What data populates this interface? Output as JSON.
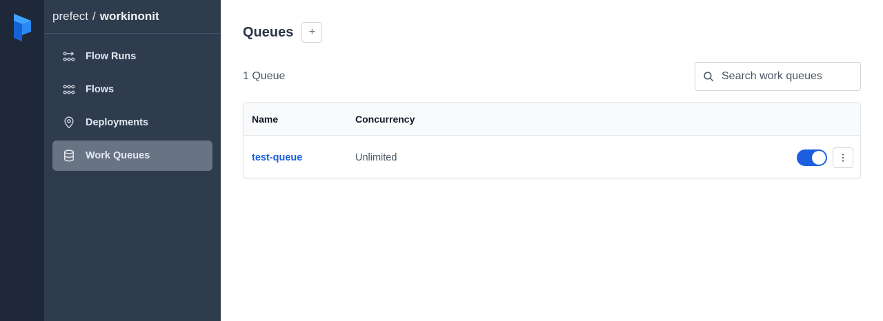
{
  "workspace": {
    "account": "prefect",
    "separator": "/",
    "name": "workinonit"
  },
  "nav": [
    {
      "label": "Flow Runs",
      "icon": "flow-runs-icon",
      "active": false
    },
    {
      "label": "Flows",
      "icon": "flows-icon",
      "active": false
    },
    {
      "label": "Deployments",
      "icon": "location-pin-icon",
      "active": false
    },
    {
      "label": "Work Queues",
      "icon": "database-icon",
      "active": true
    }
  ],
  "page": {
    "title": "Queues",
    "add_label": "+",
    "count_label": "1 Queue"
  },
  "search": {
    "placeholder": "Search work queues",
    "value": ""
  },
  "table": {
    "headers": {
      "name": "Name",
      "concurrency": "Concurrency"
    },
    "rows": [
      {
        "name": "test-queue",
        "concurrency": "Unlimited",
        "enabled": true
      }
    ]
  },
  "colors": {
    "rail": "#1f2839",
    "sidebar": "#2f3c4e",
    "active_nav": "#687484",
    "accent": "#1b5fe0",
    "logo": "#2a8af5"
  }
}
